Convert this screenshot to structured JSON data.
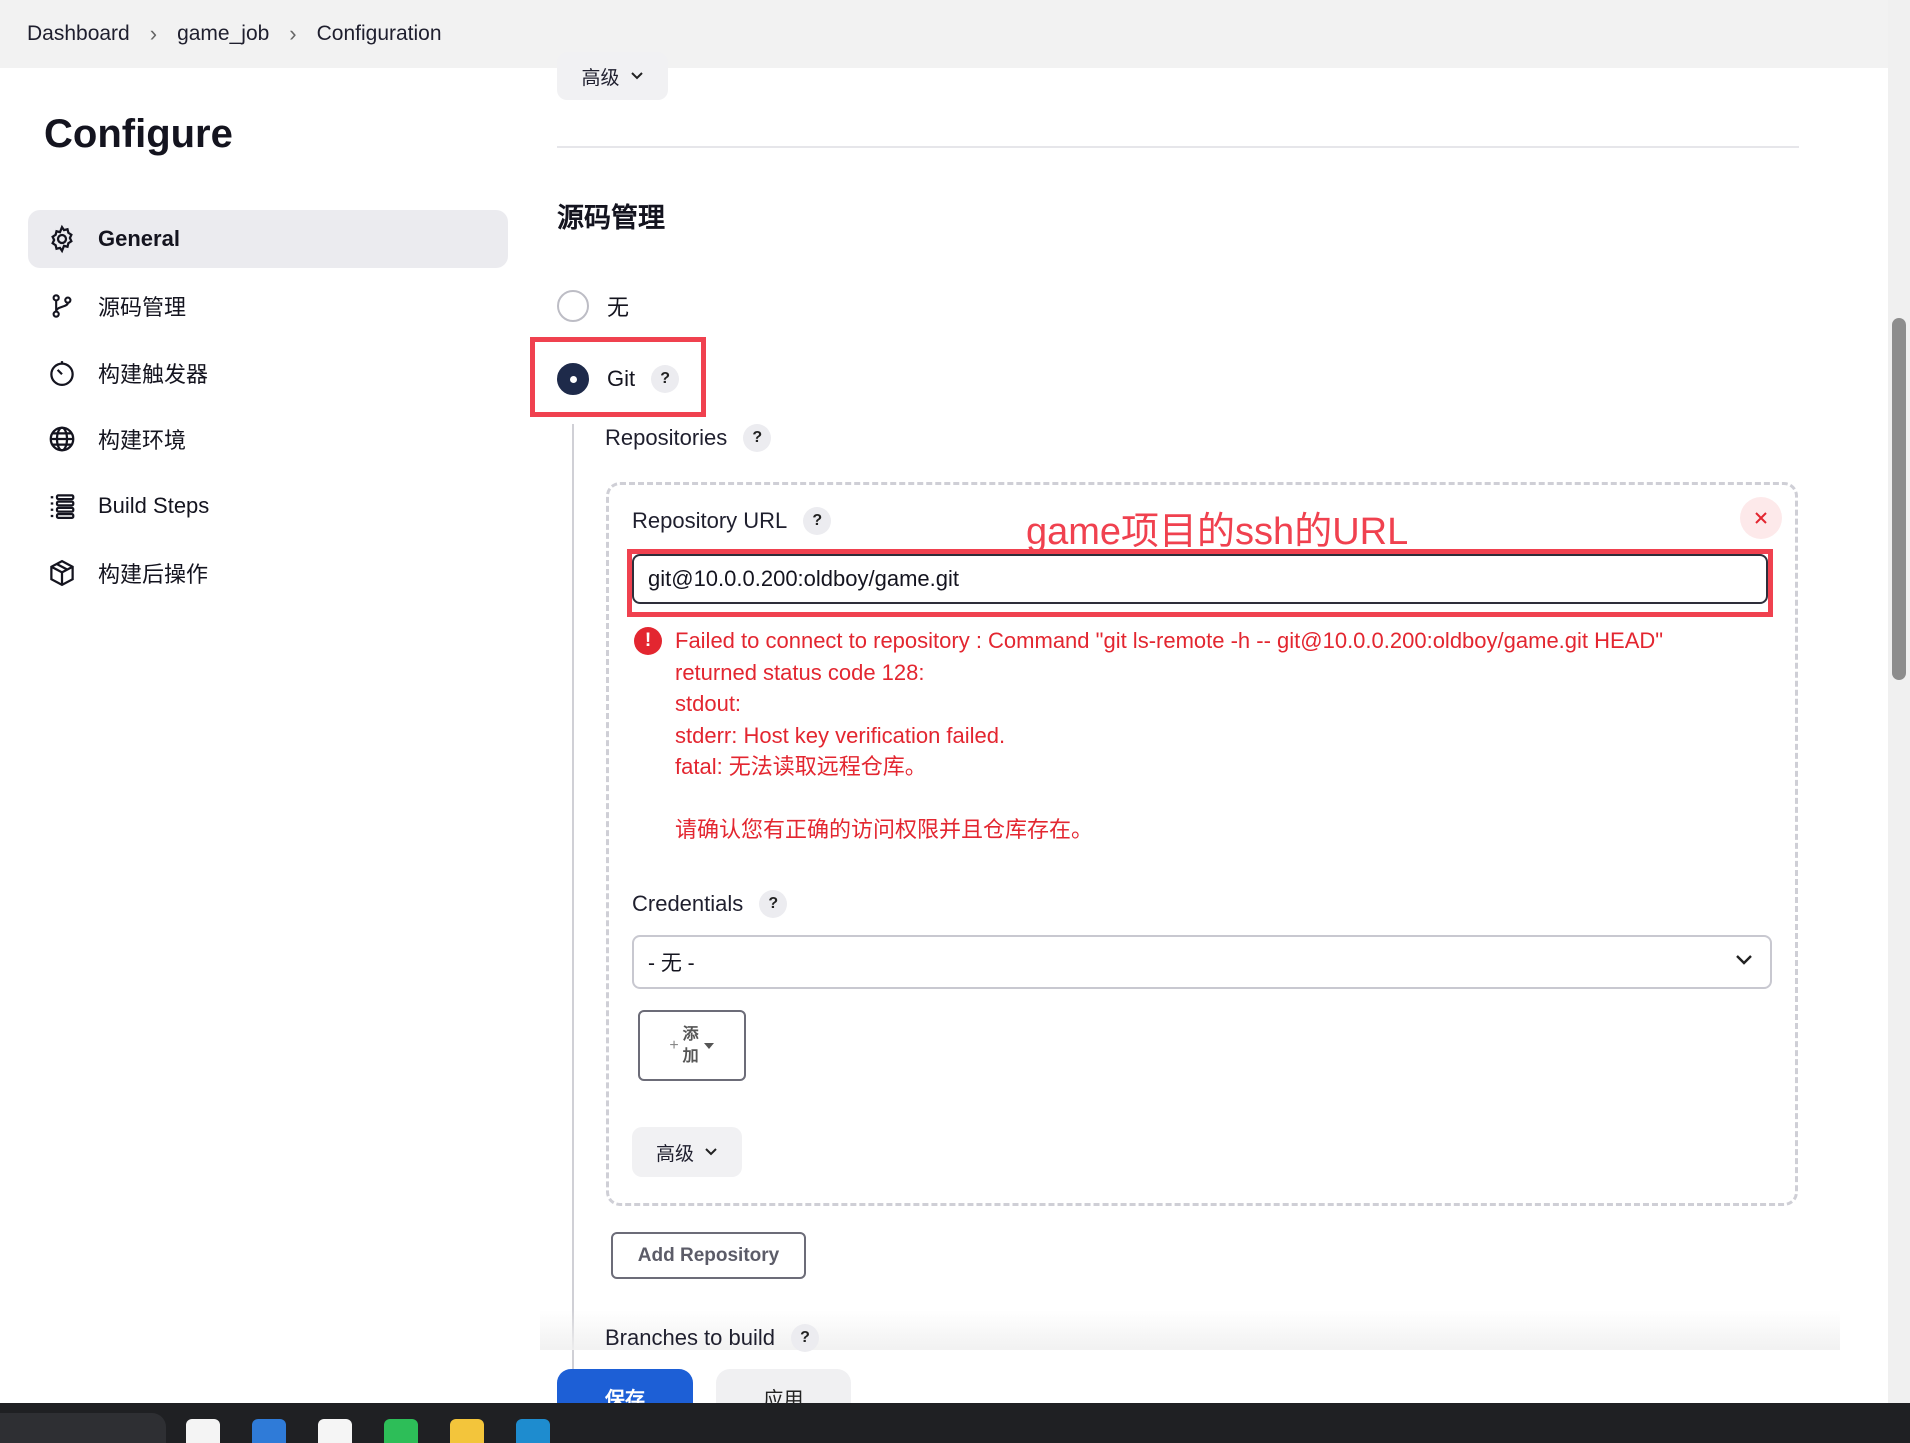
{
  "breadcrumb": {
    "items": [
      "Dashboard",
      "game_job",
      "Configuration"
    ]
  },
  "sidebar": {
    "title": "Configure",
    "items": [
      {
        "label": "General",
        "icon": "gear-icon",
        "active": true
      },
      {
        "label": "源码管理",
        "icon": "git-branch-icon"
      },
      {
        "label": "构建触发器",
        "icon": "timer-icon"
      },
      {
        "label": "构建环境",
        "icon": "globe-icon"
      },
      {
        "label": "Build Steps",
        "icon": "list-icon"
      },
      {
        "label": "构建后操作",
        "icon": "package-icon"
      }
    ]
  },
  "main": {
    "advanced_top_label": "高级",
    "section_title": "源码管理",
    "scm_options": [
      {
        "label": "无",
        "checked": false
      },
      {
        "label": "Git",
        "checked": true
      }
    ],
    "repositories_label": "Repositories",
    "repository_url_label": "Repository URL",
    "repository_url_value": "git@10.0.0.200:oldboy/game.git",
    "annotation": "game项目的ssh的URL",
    "error_lines": [
      "Failed to connect to repository : Command \"git ls-remote -h -- git@10.0.0.200:oldboy/game.git HEAD\"",
      "returned status code 128:",
      "stdout:",
      "stderr: Host key verification failed.",
      "fatal: 无法读取远程仓库。",
      "",
      "请确认您有正确的访问权限并且仓库存在。"
    ],
    "credentials_label": "Credentials",
    "credentials_selected": "- 无 -",
    "add_button": {
      "line1": "添",
      "line2": "加",
      "prefix": "+"
    },
    "advanced_label": "高级",
    "add_repository_label": "Add Repository",
    "branches_label": "Branches to build",
    "save_label": "保存",
    "apply_label": "应用"
  },
  "colors": {
    "accent_red": "#f0414f",
    "error_red": "#e32630",
    "primary_blue": "#1d5fd6",
    "radio_dark": "#1e2a4a"
  }
}
